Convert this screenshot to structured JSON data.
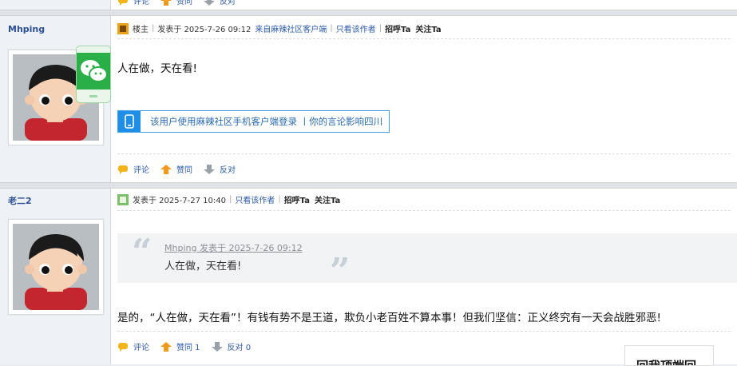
{
  "top_actions": {
    "comment": "评论",
    "like": "赞同",
    "oppose": "反对"
  },
  "posts": [
    {
      "username": "Mhping",
      "meta": {
        "floor": "楼主",
        "posted": "发表于 2025-7-26 09:12",
        "source": "来自麻辣社区客户端",
        "only_author": "只看该作者",
        "greet": "招呼Ta",
        "follow": "关注Ta"
      },
      "body": "人在做，天在看!",
      "mobile_banner": "该用户使用麻辣社区手机客户端登录 丨你的言论影响四川",
      "actions": {
        "comment": "评论",
        "like": "赞同",
        "oppose": "反对"
      }
    },
    {
      "username": "老二2",
      "meta": {
        "posted": "发表于 2025-7-27 10:40",
        "only_author": "只看该作者",
        "greet": "招呼Ta",
        "follow": "关注Ta"
      },
      "quote": {
        "header": "Mhping 发表于 2025-7-26 09:12",
        "text": "人在做，天在看!"
      },
      "body": "是的，“人在做，天在看”！有钱有势不是王道，欺负小老百姓不算本事！但我们坚信：正义终究有一天会战胜邪恶!",
      "actions": {
        "comment": "评论",
        "like": "赞同 1",
        "oppose": "反对 0"
      }
    }
  ],
  "overlay_label": "回我顶端回",
  "colors": {
    "link": "#2b5aa8",
    "sidebar": "#eef1f5",
    "wechat": "#2aae48",
    "mobile": "#1f8ee6"
  }
}
